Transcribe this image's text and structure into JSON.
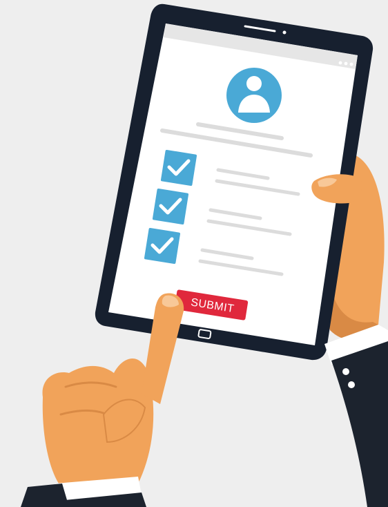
{
  "form": {
    "submit_label": "SUBMIT",
    "fields": [
      {
        "checked": true
      },
      {
        "checked": true
      },
      {
        "checked": true
      }
    ]
  },
  "colors": {
    "background": "#eeeeee",
    "tablet_frame": "#17202f",
    "screen": "#ffffff",
    "browser_bar": "#e6e6e6",
    "accent_blue": "#4aa9d6",
    "placeholder_line": "#dcdcdc",
    "submit_red": "#e0283c",
    "skin": "#f1a35a",
    "skin_shadow": "#d98a45",
    "sleeve": "#1c232e",
    "cuff": "#ffffff"
  },
  "icons": {
    "avatar": "user-icon",
    "checkbox": "check-icon",
    "home": "home-button-icon"
  }
}
